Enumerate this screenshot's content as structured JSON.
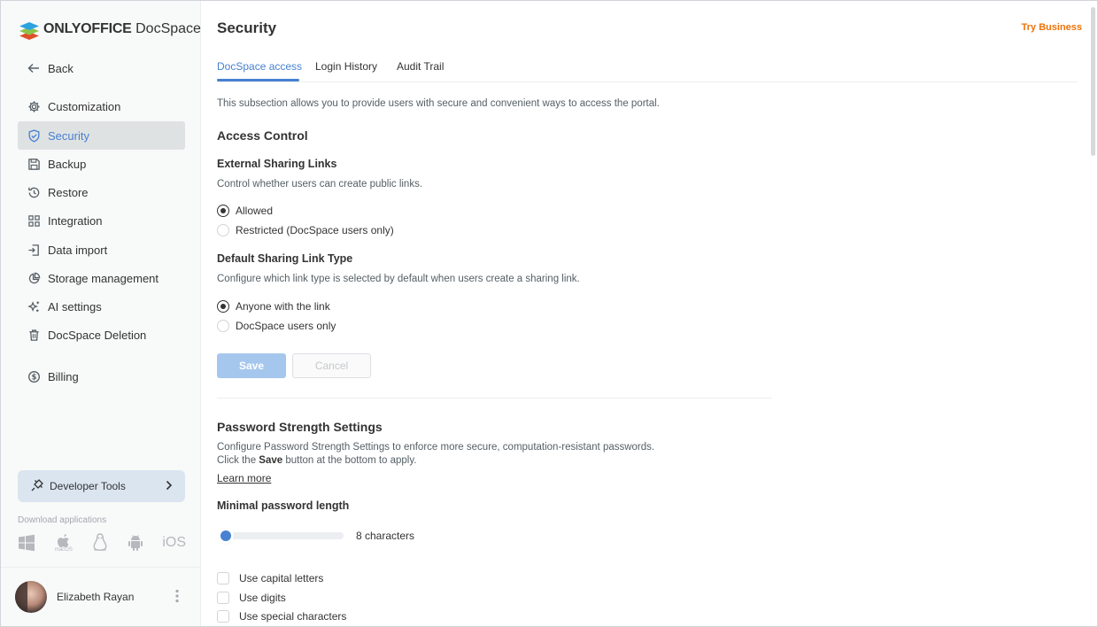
{
  "app": {
    "logo_brand": "ONLYOFFICE",
    "logo_product": "DocSpace"
  },
  "sidebar": {
    "back_label": "Back",
    "items": [
      {
        "label": "Customization",
        "icon": "gear-icon"
      },
      {
        "label": "Security",
        "icon": "shield-icon",
        "active": true
      },
      {
        "label": "Backup",
        "icon": "save-disk-icon"
      },
      {
        "label": "Restore",
        "icon": "history-icon"
      },
      {
        "label": "Integration",
        "icon": "grid-icon"
      },
      {
        "label": "Data import",
        "icon": "import-icon"
      },
      {
        "label": "Storage management",
        "icon": "pie-chart-icon"
      },
      {
        "label": "AI settings",
        "icon": "sparkle-icon"
      },
      {
        "label": "DocSpace Deletion",
        "icon": "trash-icon"
      }
    ],
    "billing_label": "Billing",
    "developer_tools_label": "Developer Tools",
    "download_title": "Download applications",
    "apps": [
      {
        "icon": "windows-icon"
      },
      {
        "icon": "apple-icon",
        "caption": "macOS"
      },
      {
        "icon": "linux-icon"
      },
      {
        "icon": "android-icon"
      },
      {
        "icon": "ios-icon",
        "text": "iOS"
      }
    ],
    "user_name": "Elizabeth Rayan"
  },
  "header": {
    "title": "Security",
    "try_business": "Try Business"
  },
  "tabs": [
    {
      "label": "DocSpace access",
      "active": true
    },
    {
      "label": "Login History"
    },
    {
      "label": "Audit Trail"
    }
  ],
  "content": {
    "intro": "This subsection allows you to provide users with secure and convenient ways to access the portal.",
    "access_control_title": "Access Control",
    "external_links": {
      "title": "External Sharing Links",
      "desc": "Control whether users can create public links.",
      "options": [
        "Allowed",
        "Restricted (DocSpace users only)"
      ],
      "selected": "Allowed"
    },
    "default_link_type": {
      "title": "Default Sharing Link Type",
      "desc": "Configure which link type is selected by default when users create a sharing link.",
      "options": [
        "Anyone with the link",
        "DocSpace users only"
      ],
      "selected": "Anyone with the link"
    },
    "save_label": "Save",
    "cancel_label": "Cancel",
    "password": {
      "title": "Password Strength Settings",
      "desc_line1": "Configure Password Strength Settings to enforce more secure, computation-resistant passwords.",
      "desc_line2_before": "Click the ",
      "desc_line2_bold": "Save",
      "desc_line2_after": " button at the bottom to apply.",
      "learn_more": "Learn more",
      "min_length_title": "Minimal password length",
      "slider_value_text": "8 characters",
      "slider_fraction": 0.0,
      "checkboxes": [
        "Use capital letters",
        "Use digits",
        "Use special characters"
      ]
    }
  },
  "colors": {
    "accent": "#4781d1",
    "try_business": "#ed7309",
    "save_disabled": "#a6c7ed"
  }
}
